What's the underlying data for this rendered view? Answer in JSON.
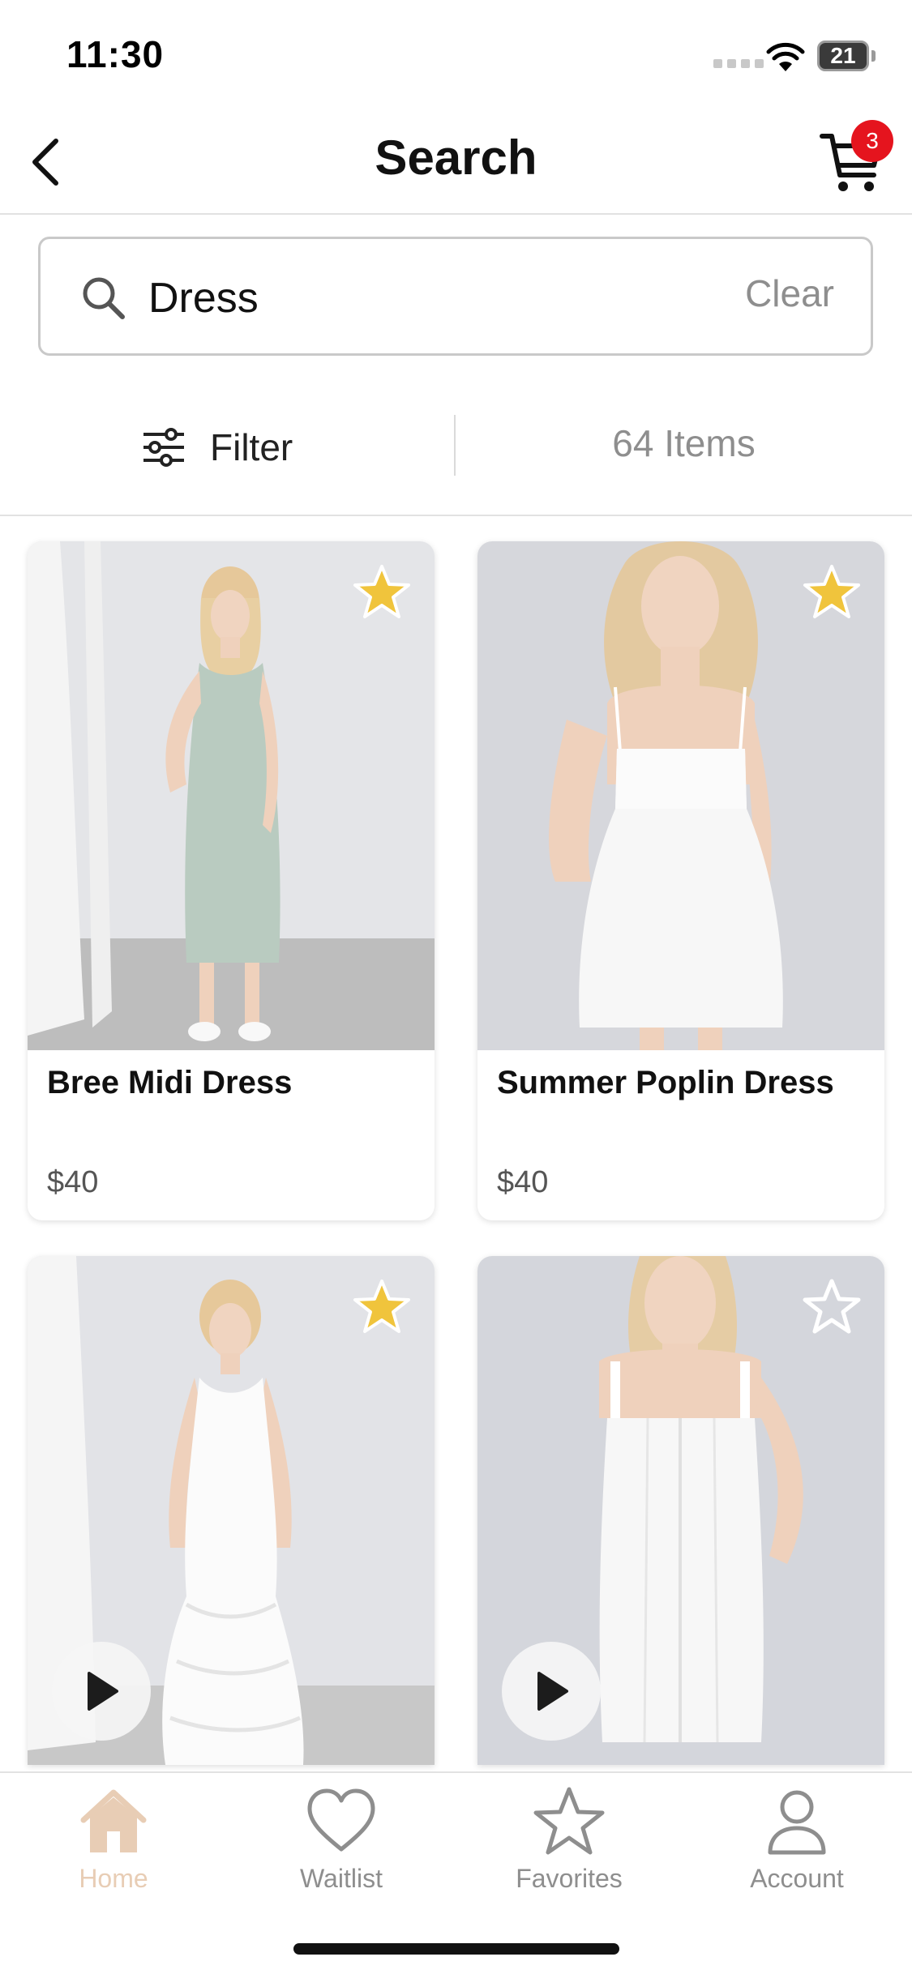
{
  "status_bar": {
    "time": "11:30",
    "battery": "21"
  },
  "nav": {
    "title": "Search",
    "cart_count": "3"
  },
  "search": {
    "value": "Dress",
    "clear_label": "Clear"
  },
  "filter": {
    "label": "Filter",
    "item_count": "64 Items"
  },
  "products": [
    {
      "name": "Bree Midi Dress",
      "price": "$40",
      "favorited": true,
      "has_video": false
    },
    {
      "name": "Summer Poplin Dress",
      "price": "$40",
      "favorited": true,
      "has_video": false
    },
    {
      "name": "",
      "price": "",
      "favorited": true,
      "has_video": true
    },
    {
      "name": "",
      "price": "",
      "favorited": false,
      "has_video": true
    }
  ],
  "tabs": [
    {
      "label": "Home",
      "icon": "home-icon",
      "active": true
    },
    {
      "label": "Waitlist",
      "icon": "heart-icon",
      "active": false
    },
    {
      "label": "Favorites",
      "icon": "star-icon",
      "active": false
    },
    {
      "label": "Account",
      "icon": "person-icon",
      "active": false
    }
  ],
  "colors": {
    "accent": "#e8cdb5",
    "star_fill": "#f0c43c",
    "badge": "#e5141e",
    "inactive": "#8e8e8e"
  }
}
